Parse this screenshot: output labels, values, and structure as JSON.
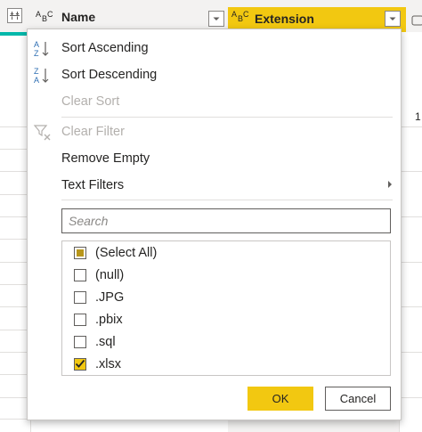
{
  "header": {
    "columns": [
      {
        "type_icon": "abc-text-type-icon",
        "name": "Name"
      },
      {
        "type_icon": "abc-text-type-icon",
        "name": "Extension",
        "highlight_color": "#f2c811"
      }
    ],
    "right_value": "1"
  },
  "menu": {
    "sort_ascending": "Sort Ascending",
    "sort_descending": "Sort Descending",
    "clear_sort": "Clear Sort",
    "clear_filter": "Clear Filter",
    "remove_empty": "Remove Empty",
    "text_filters": "Text Filters",
    "search_placeholder": "Search",
    "search_value": "",
    "items": [
      {
        "label": "(Select All)",
        "state": "indeterminate"
      },
      {
        "label": "(null)",
        "state": "unchecked"
      },
      {
        "label": ".JPG",
        "state": "unchecked"
      },
      {
        "label": ".pbix",
        "state": "unchecked"
      },
      {
        "label": ".sql",
        "state": "unchecked"
      },
      {
        "label": ".xlsx",
        "state": "checked"
      }
    ],
    "ok": "OK",
    "cancel": "Cancel"
  },
  "colors": {
    "accent": "#f2c811",
    "teal": "#01b8aa",
    "disabled_text": "#b3b0ad"
  }
}
